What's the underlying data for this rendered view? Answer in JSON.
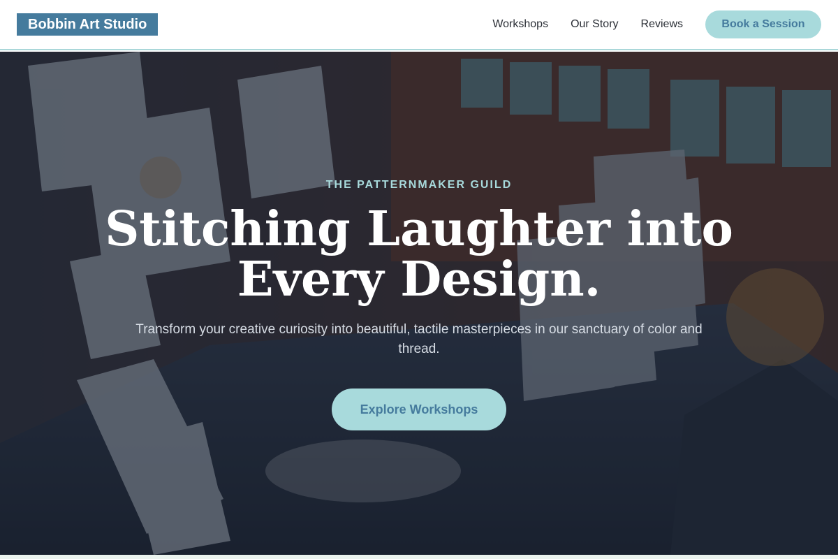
{
  "header": {
    "logo": "Bobbin Art Studio",
    "nav": [
      {
        "label": "Workshops"
      },
      {
        "label": "Our Story"
      },
      {
        "label": "Reviews"
      }
    ],
    "cta": "Book a Session"
  },
  "hero": {
    "eyebrow": "THE PATTERNMAKER GUILD",
    "headline_line1": "Stitching Laughter into",
    "headline_line2": "Every Design.",
    "subtitle": "Transform your creative curiosity into beautiful, tactile masterpieces in our sanctuary of color and thread.",
    "cta": "Explore Workshops"
  },
  "colors": {
    "brand": "#457b9d",
    "accent": "#a8dadc",
    "hero_overlay": "#121a28"
  }
}
